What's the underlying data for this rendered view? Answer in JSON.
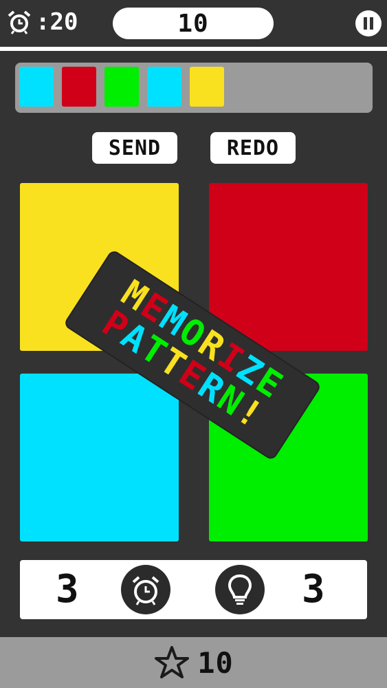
{
  "hud": {
    "timer": ":20",
    "score": "10"
  },
  "pattern_slots": [
    "#00e1ff",
    "#d00018",
    "#00ee00",
    "#00e1ff",
    "#f9e11f"
  ],
  "buttons": {
    "send": "SEND",
    "redo": "REDO"
  },
  "pads": {
    "yellow": "#f9e11f",
    "red": "#d00018",
    "cyan": "#00e1ff",
    "green": "#00ee00"
  },
  "banner": {
    "line1": "MEMORIZE",
    "line2": "PATTERN!"
  },
  "powerups": {
    "time_count": "3",
    "hint_count": "3",
    "time_icon": "alarm-clock-icon",
    "hint_icon": "lightbulb-icon"
  },
  "footer": {
    "stars": "10",
    "icon": "star-icon"
  }
}
